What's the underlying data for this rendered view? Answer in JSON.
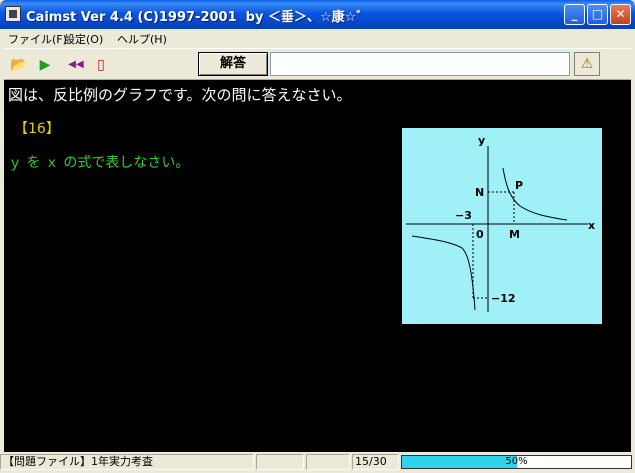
{
  "window": {
    "title": "Caimst Ver 4.4 (C)1997-2001  by ＜垂＞、☆康☆゛",
    "minimize_glyph": "_",
    "maximize_glyph": "□",
    "close_glyph": "✕"
  },
  "menu": {
    "items": [
      {
        "label": "ファイル(F)"
      },
      {
        "label": "設定(O)"
      },
      {
        "label": "ヘルプ(H)"
      }
    ]
  },
  "toolbar": {
    "open_icon": "📂",
    "play_icon": "▶",
    "rewind_icon": "◀◀",
    "exit_icon": "▯",
    "answer_button_label": "解答",
    "answer_input_value": "",
    "hint_icon": "⚠"
  },
  "question": {
    "intro": "図は、反比例のグラフです。次の問に答えなさい。",
    "number": "【16】",
    "text": "ｙ を ｘ の式で表しなさい。"
  },
  "graph": {
    "label_y": "y",
    "label_x": "x",
    "label_n": "N",
    "label_p": "P",
    "label_minus3": "−3",
    "label_origin": "0",
    "label_m": "M",
    "label_minus12": "−12"
  },
  "status": {
    "file_label": "【問題ファイル】1年実力考査",
    "progress_count": "15/30",
    "progress_percent": 50,
    "progress_text": "50%",
    "progress_color": "#2fd4ec"
  }
}
